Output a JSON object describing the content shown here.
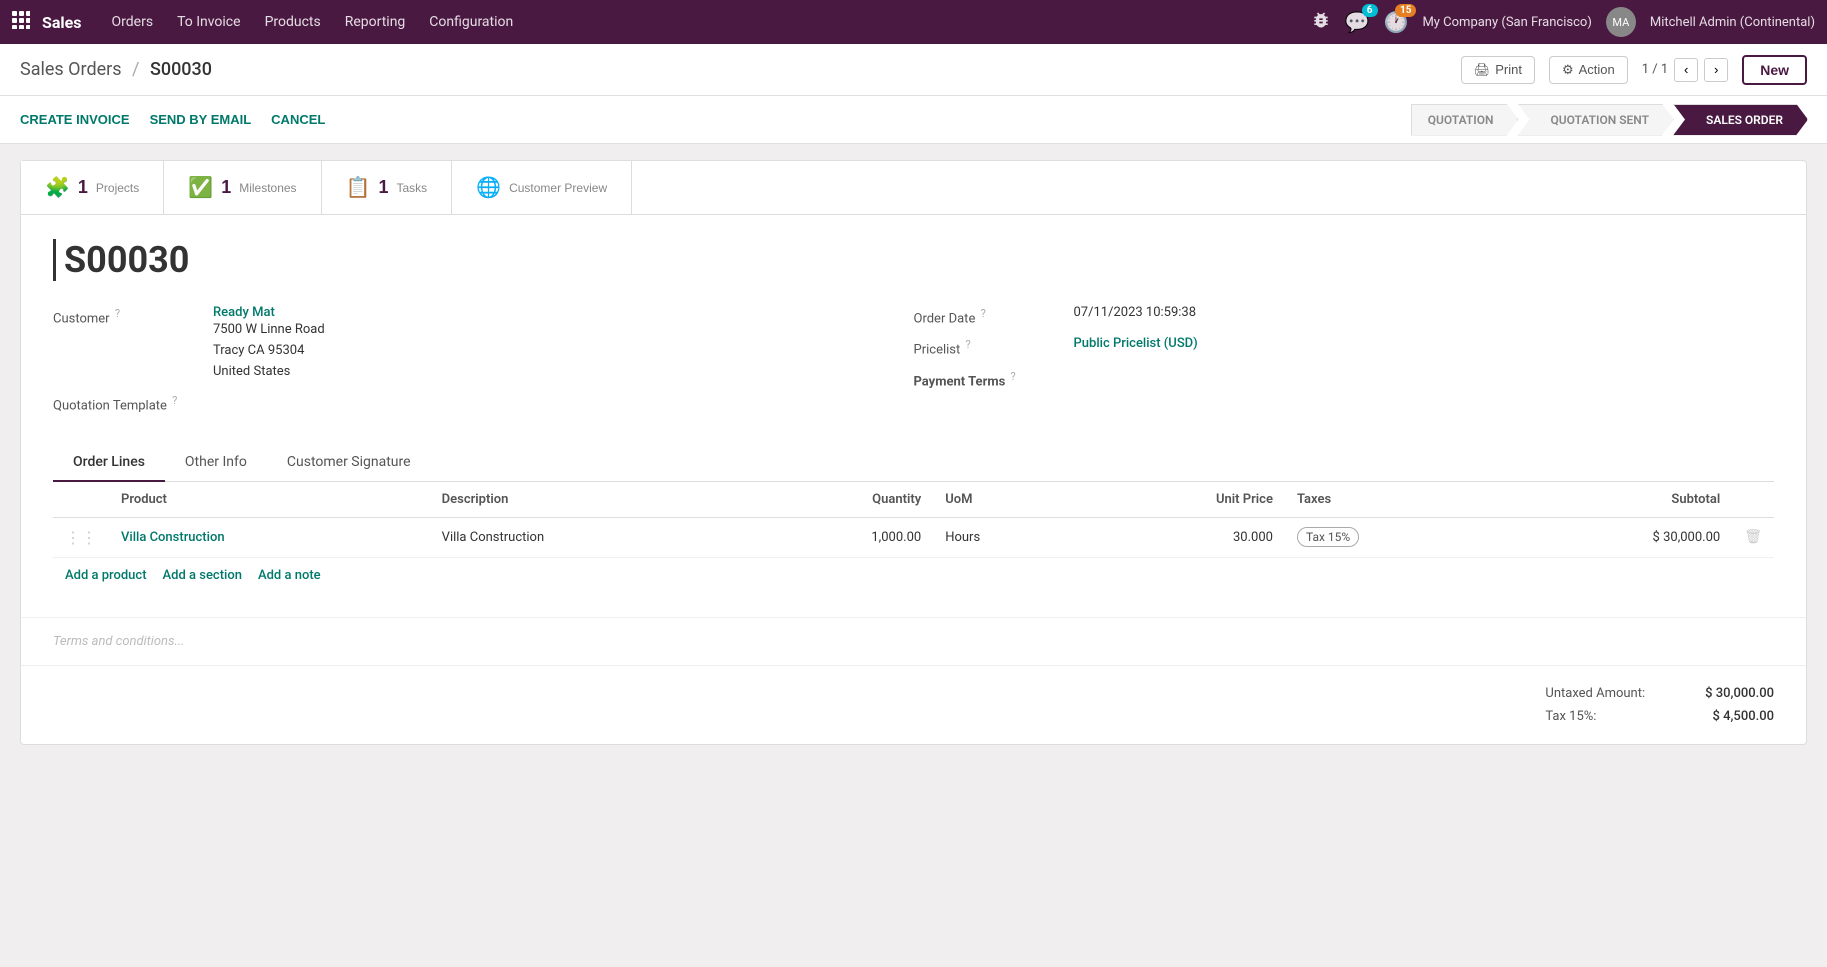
{
  "topnav": {
    "brand": "Sales",
    "items": [
      "Orders",
      "To Invoice",
      "Products",
      "Reporting",
      "Configuration"
    ],
    "messages_count": "6",
    "activities_count": "15",
    "company": "My Company (San Francisco)",
    "user": "Mitchell Admin (Continental)"
  },
  "breadcrumb": {
    "parent": "Sales Orders",
    "separator": "/",
    "current": "S00030"
  },
  "titlebar": {
    "print_label": "Print",
    "action_label": "Action",
    "pagination": "1 / 1",
    "new_label": "New"
  },
  "actionbar": {
    "create_invoice": "CREATE INVOICE",
    "send_by_email": "SEND BY EMAIL",
    "cancel": "CANCEL"
  },
  "pipeline": {
    "steps": [
      "QUOTATION",
      "QUOTATION SENT",
      "SALES ORDER"
    ]
  },
  "smart_buttons": [
    {
      "count": "1",
      "label": "Projects",
      "icon": "puzzle"
    },
    {
      "count": "1",
      "label": "Milestones",
      "icon": "check"
    },
    {
      "count": "1",
      "label": "Tasks",
      "icon": "list"
    },
    {
      "count": "",
      "label": "Customer Preview",
      "icon": "globe"
    }
  ],
  "form": {
    "order_number": "S00030",
    "customer_label": "Customer",
    "customer_name": "Ready Mat",
    "customer_address_line1": "7500 W Linne Road",
    "customer_address_line2": "Tracy CA 95304",
    "customer_address_line3": "United States",
    "quotation_template_label": "Quotation Template",
    "order_date_label": "Order Date",
    "order_date_value": "07/11/2023 10:59:38",
    "pricelist_label": "Pricelist",
    "pricelist_value": "Public Pricelist (USD)",
    "payment_terms_label": "Payment Terms",
    "payment_terms_value": ""
  },
  "tabs": [
    "Order Lines",
    "Other Info",
    "Customer Signature"
  ],
  "table": {
    "headers": [
      "Product",
      "Description",
      "Quantity",
      "UoM",
      "Unit Price",
      "Taxes",
      "Subtotal"
    ],
    "rows": [
      {
        "product": "Villa Construction",
        "description": "Villa Construction",
        "quantity": "1,000.00",
        "uom": "Hours",
        "unit_price": "30.000",
        "tax": "Tax 15%",
        "subtotal": "$ 30,000.00"
      }
    ]
  },
  "add_links": [
    "Add a product",
    "Add a section",
    "Add a note"
  ],
  "terms_placeholder": "Terms and conditions...",
  "totals": {
    "untaxed_label": "Untaxed Amount:",
    "untaxed_value": "$ 30,000.00",
    "tax_label": "Tax 15%:",
    "tax_value": "$ 4,500.00"
  }
}
